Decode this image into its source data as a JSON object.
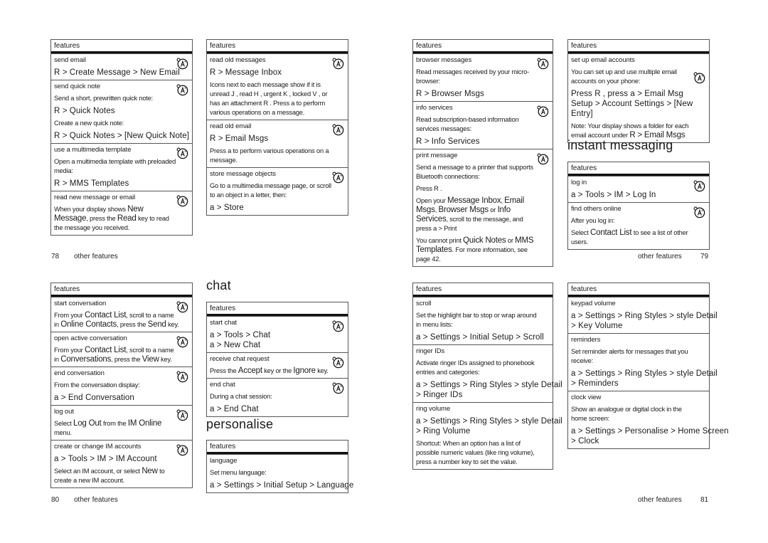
{
  "table_header": "features",
  "pages": {
    "p78": {
      "number": "78",
      "label": "other features"
    },
    "p79": {
      "number": "79",
      "label": "other features"
    },
    "p80": {
      "number": "80",
      "label": "other features"
    },
    "p81": {
      "number": "81",
      "label": "other features"
    }
  },
  "headings": {
    "instant_messaging": "instant messaging",
    "chat": "chat",
    "personalise": "personalise"
  },
  "t1": {
    "rows": [
      {
        "title": "send email",
        "menu1": "R  > Create Message > New Email"
      },
      {
        "title": "send quick note",
        "p1": "Send a short, prewritten quick note:",
        "menu1": "R  > Quick Notes",
        "p2": "Create a new quick note:",
        "menu2": "R  > Quick Notes > [New Quick Note]"
      },
      {
        "title": "use a multimedia template",
        "p1": "Open a multimedia template with preloaded media:",
        "menu1": "R  > MMS Templates"
      },
      {
        "title": "read new message or email",
        "p1a": "When your display shows ",
        "k1": "New Message",
        "p1b": ", press the ",
        "k2": "Read",
        "p1c": " key to read the message you received."
      }
    ]
  },
  "t2": {
    "rows": [
      {
        "title": "read old messages",
        "menu1": "R  > Message Inbox",
        "p1": "Icons next to each message show if it is unread J , read H , urgent K , locked V , or has an attachment R . Press a to perform various operations on a message."
      },
      {
        "title": "read old email",
        "menu1": "R  > Email Msgs",
        "p1": "Press a  to perform various operations on a message."
      },
      {
        "title": "store message objects",
        "p1": "Go to a multimedia message page, or scroll to an object in a letter, then:",
        "menu1": "a  > Store"
      }
    ]
  },
  "t3": {
    "rows": [
      {
        "title": "browser messages",
        "p1": "Read messages received by your micro-browser:",
        "menu1": "R  > Browser Msgs"
      },
      {
        "title": "info services",
        "p1": "Read subscription-based information services messages:",
        "menu1": "R  > Info Services"
      },
      {
        "title": "print message",
        "p1": "Send a message to a printer that supports Bluetooth connections:",
        "p2": "Press R .",
        "p3a": "Open your ",
        "k1": "Message Inbox",
        "p3b": ", ",
        "k2": "Email Msgs",
        "p3c": ", ",
        "k3": "Browser Msgs",
        "p3d": " or ",
        "k4": "Info Services",
        "p3e": ", scroll to the message, and press a  > Print",
        "p4a": "You cannot print ",
        "k5": "Quick Notes",
        "p4b": " or ",
        "k6": "MMS Templates",
        "p4c": ". For more information, see page 42."
      }
    ]
  },
  "t4": {
    "rows": [
      {
        "title": "set up email accounts",
        "p1": "You can set up and use multiple email accounts on your phone:",
        "menu1": "Press R , press a  > Email Msg Setup > Account Settings > [New Entry]",
        "p2a": "Note:  Your display shows a folder for each email account under ",
        "k1": "R  > Email Msgs"
      }
    ]
  },
  "t5": {
    "rows": [
      {
        "title": "log in",
        "menu1": "a  > Tools > IM > Log In"
      },
      {
        "title": "find others online",
        "p1": "After you log in:",
        "p2a": "Select ",
        "k1": "Contact List",
        "p2b": " to see a list of other users."
      }
    ]
  },
  "t6": {
    "rows": [
      {
        "title": "start conversation",
        "p1a": "From your ",
        "k1": "Contact List",
        "p1b": ", scroll to a name in ",
        "k2": "Online Contacts",
        "p1c": ", press the ",
        "k3": "Send",
        "p1d": " key."
      },
      {
        "title": "open active conversation",
        "p1a": "From your ",
        "k1": "Contact List",
        "p1b": ", scroll to a name in ",
        "k2": "Conversations",
        "p1c": ", press the ",
        "k3": "View",
        "p1d": " key."
      },
      {
        "title": "end conversation",
        "p1": "From the conversation display:",
        "menu1": "a  > End Conversation"
      },
      {
        "title": "log out",
        "p1a": "Select ",
        "k1": "Log Out",
        "p1b": " from the ",
        "k2": "IM Online",
        "p1c": " menu."
      },
      {
        "title": "create or change IM accounts",
        "menu1": "a  > Tools > IM > IM Account",
        "p1a": "Select an IM account, or select ",
        "k1": "New",
        "p1b": " to create a new IM account."
      }
    ]
  },
  "t7": {
    "rows": [
      {
        "title": "start chat",
        "menu1": "a  > Tools > Chat",
        "menu2": "a  > New Chat"
      },
      {
        "title": "receive chat request",
        "p1a": "Press the ",
        "k1": "Accept",
        "p1b": " key or the ",
        "k2": "Ignore",
        "p1c": " key."
      },
      {
        "title": "end chat",
        "p1": "During a chat session:",
        "menu1": "a  > End Chat"
      }
    ]
  },
  "t8": {
    "rows": [
      {
        "title": "language",
        "p1": "Set menu language:",
        "menu1": "a  > Settings > Initial Setup > Language"
      }
    ]
  },
  "t9": {
    "rows": [
      {
        "title": "scroll",
        "p1": "Set the highlight bar to stop or wrap around in menu lists:",
        "menu1": "a  > Settings > Initial Setup > Scroll"
      },
      {
        "title": "ringer IDs",
        "p1": "Activate ringer IDs assigned to phonebook entries and categories:",
        "menu1": "a  > Settings > Ring Styles > style Detail",
        "menu2": "> Ringer IDs"
      },
      {
        "title": "ring volume",
        "menu1": "a  > Settings > Ring Styles > style Detail",
        "menu2": "> Ring Volume",
        "p1": "Shortcut:  When an option has a list of possible numeric values (like ring volume), press a number key to set the value."
      }
    ]
  },
  "t10": {
    "rows": [
      {
        "title": "keypad volume",
        "menu1": "a  > Settings > Ring Styles > style Detail",
        "menu2": "> Key Volume"
      },
      {
        "title": "reminders",
        "p1": "Set reminder alerts for messages that you receive:",
        "menu1": "a  > Settings > Ring Styles > style Detail",
        "menu2": "> Reminders"
      },
      {
        "title": "clock view",
        "p1": "Show an analogue or digital clock in the home screen:",
        "menu1": "a  > Settings > Personalise > Home Screen",
        "menu2": "> Clock"
      }
    ]
  },
  "icons": {
    "network_feature": "network-feature-icon"
  }
}
